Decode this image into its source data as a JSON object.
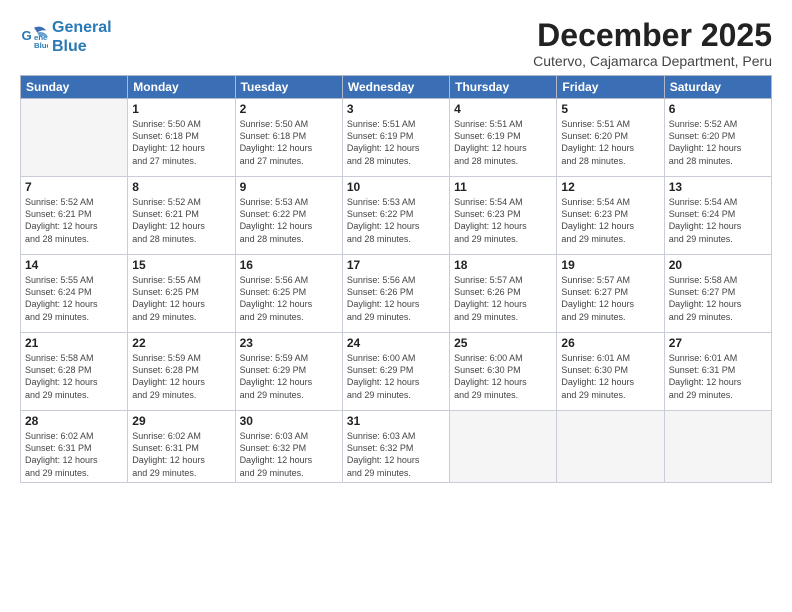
{
  "logo": {
    "line1": "General",
    "line2": "Blue"
  },
  "header": {
    "month": "December 2025",
    "location": "Cutervo, Cajamarca Department, Peru"
  },
  "weekdays": [
    "Sunday",
    "Monday",
    "Tuesday",
    "Wednesday",
    "Thursday",
    "Friday",
    "Saturday"
  ],
  "weeks": [
    [
      {
        "day": "",
        "info": ""
      },
      {
        "day": "1",
        "info": "Sunrise: 5:50 AM\nSunset: 6:18 PM\nDaylight: 12 hours\nand 27 minutes."
      },
      {
        "day": "2",
        "info": "Sunrise: 5:50 AM\nSunset: 6:18 PM\nDaylight: 12 hours\nand 27 minutes."
      },
      {
        "day": "3",
        "info": "Sunrise: 5:51 AM\nSunset: 6:19 PM\nDaylight: 12 hours\nand 28 minutes."
      },
      {
        "day": "4",
        "info": "Sunrise: 5:51 AM\nSunset: 6:19 PM\nDaylight: 12 hours\nand 28 minutes."
      },
      {
        "day": "5",
        "info": "Sunrise: 5:51 AM\nSunset: 6:20 PM\nDaylight: 12 hours\nand 28 minutes."
      },
      {
        "day": "6",
        "info": "Sunrise: 5:52 AM\nSunset: 6:20 PM\nDaylight: 12 hours\nand 28 minutes."
      }
    ],
    [
      {
        "day": "7",
        "info": "Sunrise: 5:52 AM\nSunset: 6:21 PM\nDaylight: 12 hours\nand 28 minutes."
      },
      {
        "day": "8",
        "info": "Sunrise: 5:52 AM\nSunset: 6:21 PM\nDaylight: 12 hours\nand 28 minutes."
      },
      {
        "day": "9",
        "info": "Sunrise: 5:53 AM\nSunset: 6:22 PM\nDaylight: 12 hours\nand 28 minutes."
      },
      {
        "day": "10",
        "info": "Sunrise: 5:53 AM\nSunset: 6:22 PM\nDaylight: 12 hours\nand 28 minutes."
      },
      {
        "day": "11",
        "info": "Sunrise: 5:54 AM\nSunset: 6:23 PM\nDaylight: 12 hours\nand 29 minutes."
      },
      {
        "day": "12",
        "info": "Sunrise: 5:54 AM\nSunset: 6:23 PM\nDaylight: 12 hours\nand 29 minutes."
      },
      {
        "day": "13",
        "info": "Sunrise: 5:54 AM\nSunset: 6:24 PM\nDaylight: 12 hours\nand 29 minutes."
      }
    ],
    [
      {
        "day": "14",
        "info": "Sunrise: 5:55 AM\nSunset: 6:24 PM\nDaylight: 12 hours\nand 29 minutes."
      },
      {
        "day": "15",
        "info": "Sunrise: 5:55 AM\nSunset: 6:25 PM\nDaylight: 12 hours\nand 29 minutes."
      },
      {
        "day": "16",
        "info": "Sunrise: 5:56 AM\nSunset: 6:25 PM\nDaylight: 12 hours\nand 29 minutes."
      },
      {
        "day": "17",
        "info": "Sunrise: 5:56 AM\nSunset: 6:26 PM\nDaylight: 12 hours\nand 29 minutes."
      },
      {
        "day": "18",
        "info": "Sunrise: 5:57 AM\nSunset: 6:26 PM\nDaylight: 12 hours\nand 29 minutes."
      },
      {
        "day": "19",
        "info": "Sunrise: 5:57 AM\nSunset: 6:27 PM\nDaylight: 12 hours\nand 29 minutes."
      },
      {
        "day": "20",
        "info": "Sunrise: 5:58 AM\nSunset: 6:27 PM\nDaylight: 12 hours\nand 29 minutes."
      }
    ],
    [
      {
        "day": "21",
        "info": "Sunrise: 5:58 AM\nSunset: 6:28 PM\nDaylight: 12 hours\nand 29 minutes."
      },
      {
        "day": "22",
        "info": "Sunrise: 5:59 AM\nSunset: 6:28 PM\nDaylight: 12 hours\nand 29 minutes."
      },
      {
        "day": "23",
        "info": "Sunrise: 5:59 AM\nSunset: 6:29 PM\nDaylight: 12 hours\nand 29 minutes."
      },
      {
        "day": "24",
        "info": "Sunrise: 6:00 AM\nSunset: 6:29 PM\nDaylight: 12 hours\nand 29 minutes."
      },
      {
        "day": "25",
        "info": "Sunrise: 6:00 AM\nSunset: 6:30 PM\nDaylight: 12 hours\nand 29 minutes."
      },
      {
        "day": "26",
        "info": "Sunrise: 6:01 AM\nSunset: 6:30 PM\nDaylight: 12 hours\nand 29 minutes."
      },
      {
        "day": "27",
        "info": "Sunrise: 6:01 AM\nSunset: 6:31 PM\nDaylight: 12 hours\nand 29 minutes."
      }
    ],
    [
      {
        "day": "28",
        "info": "Sunrise: 6:02 AM\nSunset: 6:31 PM\nDaylight: 12 hours\nand 29 minutes."
      },
      {
        "day": "29",
        "info": "Sunrise: 6:02 AM\nSunset: 6:31 PM\nDaylight: 12 hours\nand 29 minutes."
      },
      {
        "day": "30",
        "info": "Sunrise: 6:03 AM\nSunset: 6:32 PM\nDaylight: 12 hours\nand 29 minutes."
      },
      {
        "day": "31",
        "info": "Sunrise: 6:03 AM\nSunset: 6:32 PM\nDaylight: 12 hours\nand 29 minutes."
      },
      {
        "day": "",
        "info": ""
      },
      {
        "day": "",
        "info": ""
      },
      {
        "day": "",
        "info": ""
      }
    ]
  ]
}
